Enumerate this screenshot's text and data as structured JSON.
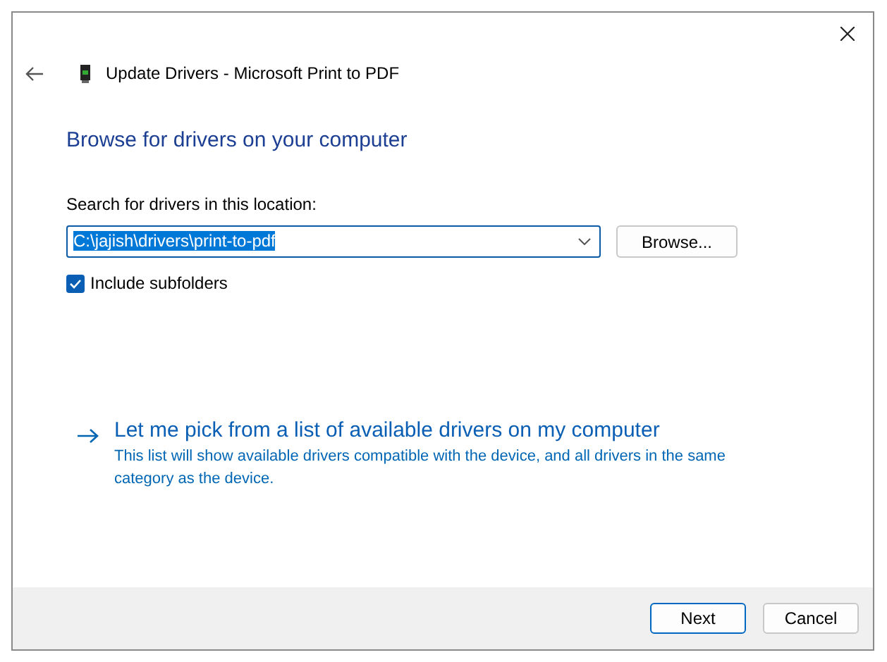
{
  "window": {
    "title": "Update Drivers - Microsoft Print to PDF"
  },
  "heading": "Browse for drivers on your computer",
  "location": {
    "label": "Search for drivers in this location:",
    "value": "C:\\jajish\\drivers\\print-to-pdf",
    "value_selected": true
  },
  "browse_button": "Browse...",
  "include_subfolders": {
    "label": "Include subfolders",
    "checked": true
  },
  "pick_link": {
    "label": "Let me pick from a list of available drivers on my computer",
    "description": "This list will show available drivers compatible with the device, and all drivers in the same category as the device."
  },
  "buttons": [
    {
      "label": "Next",
      "default": true
    },
    {
      "label": "Cancel",
      "default": false
    }
  ]
}
